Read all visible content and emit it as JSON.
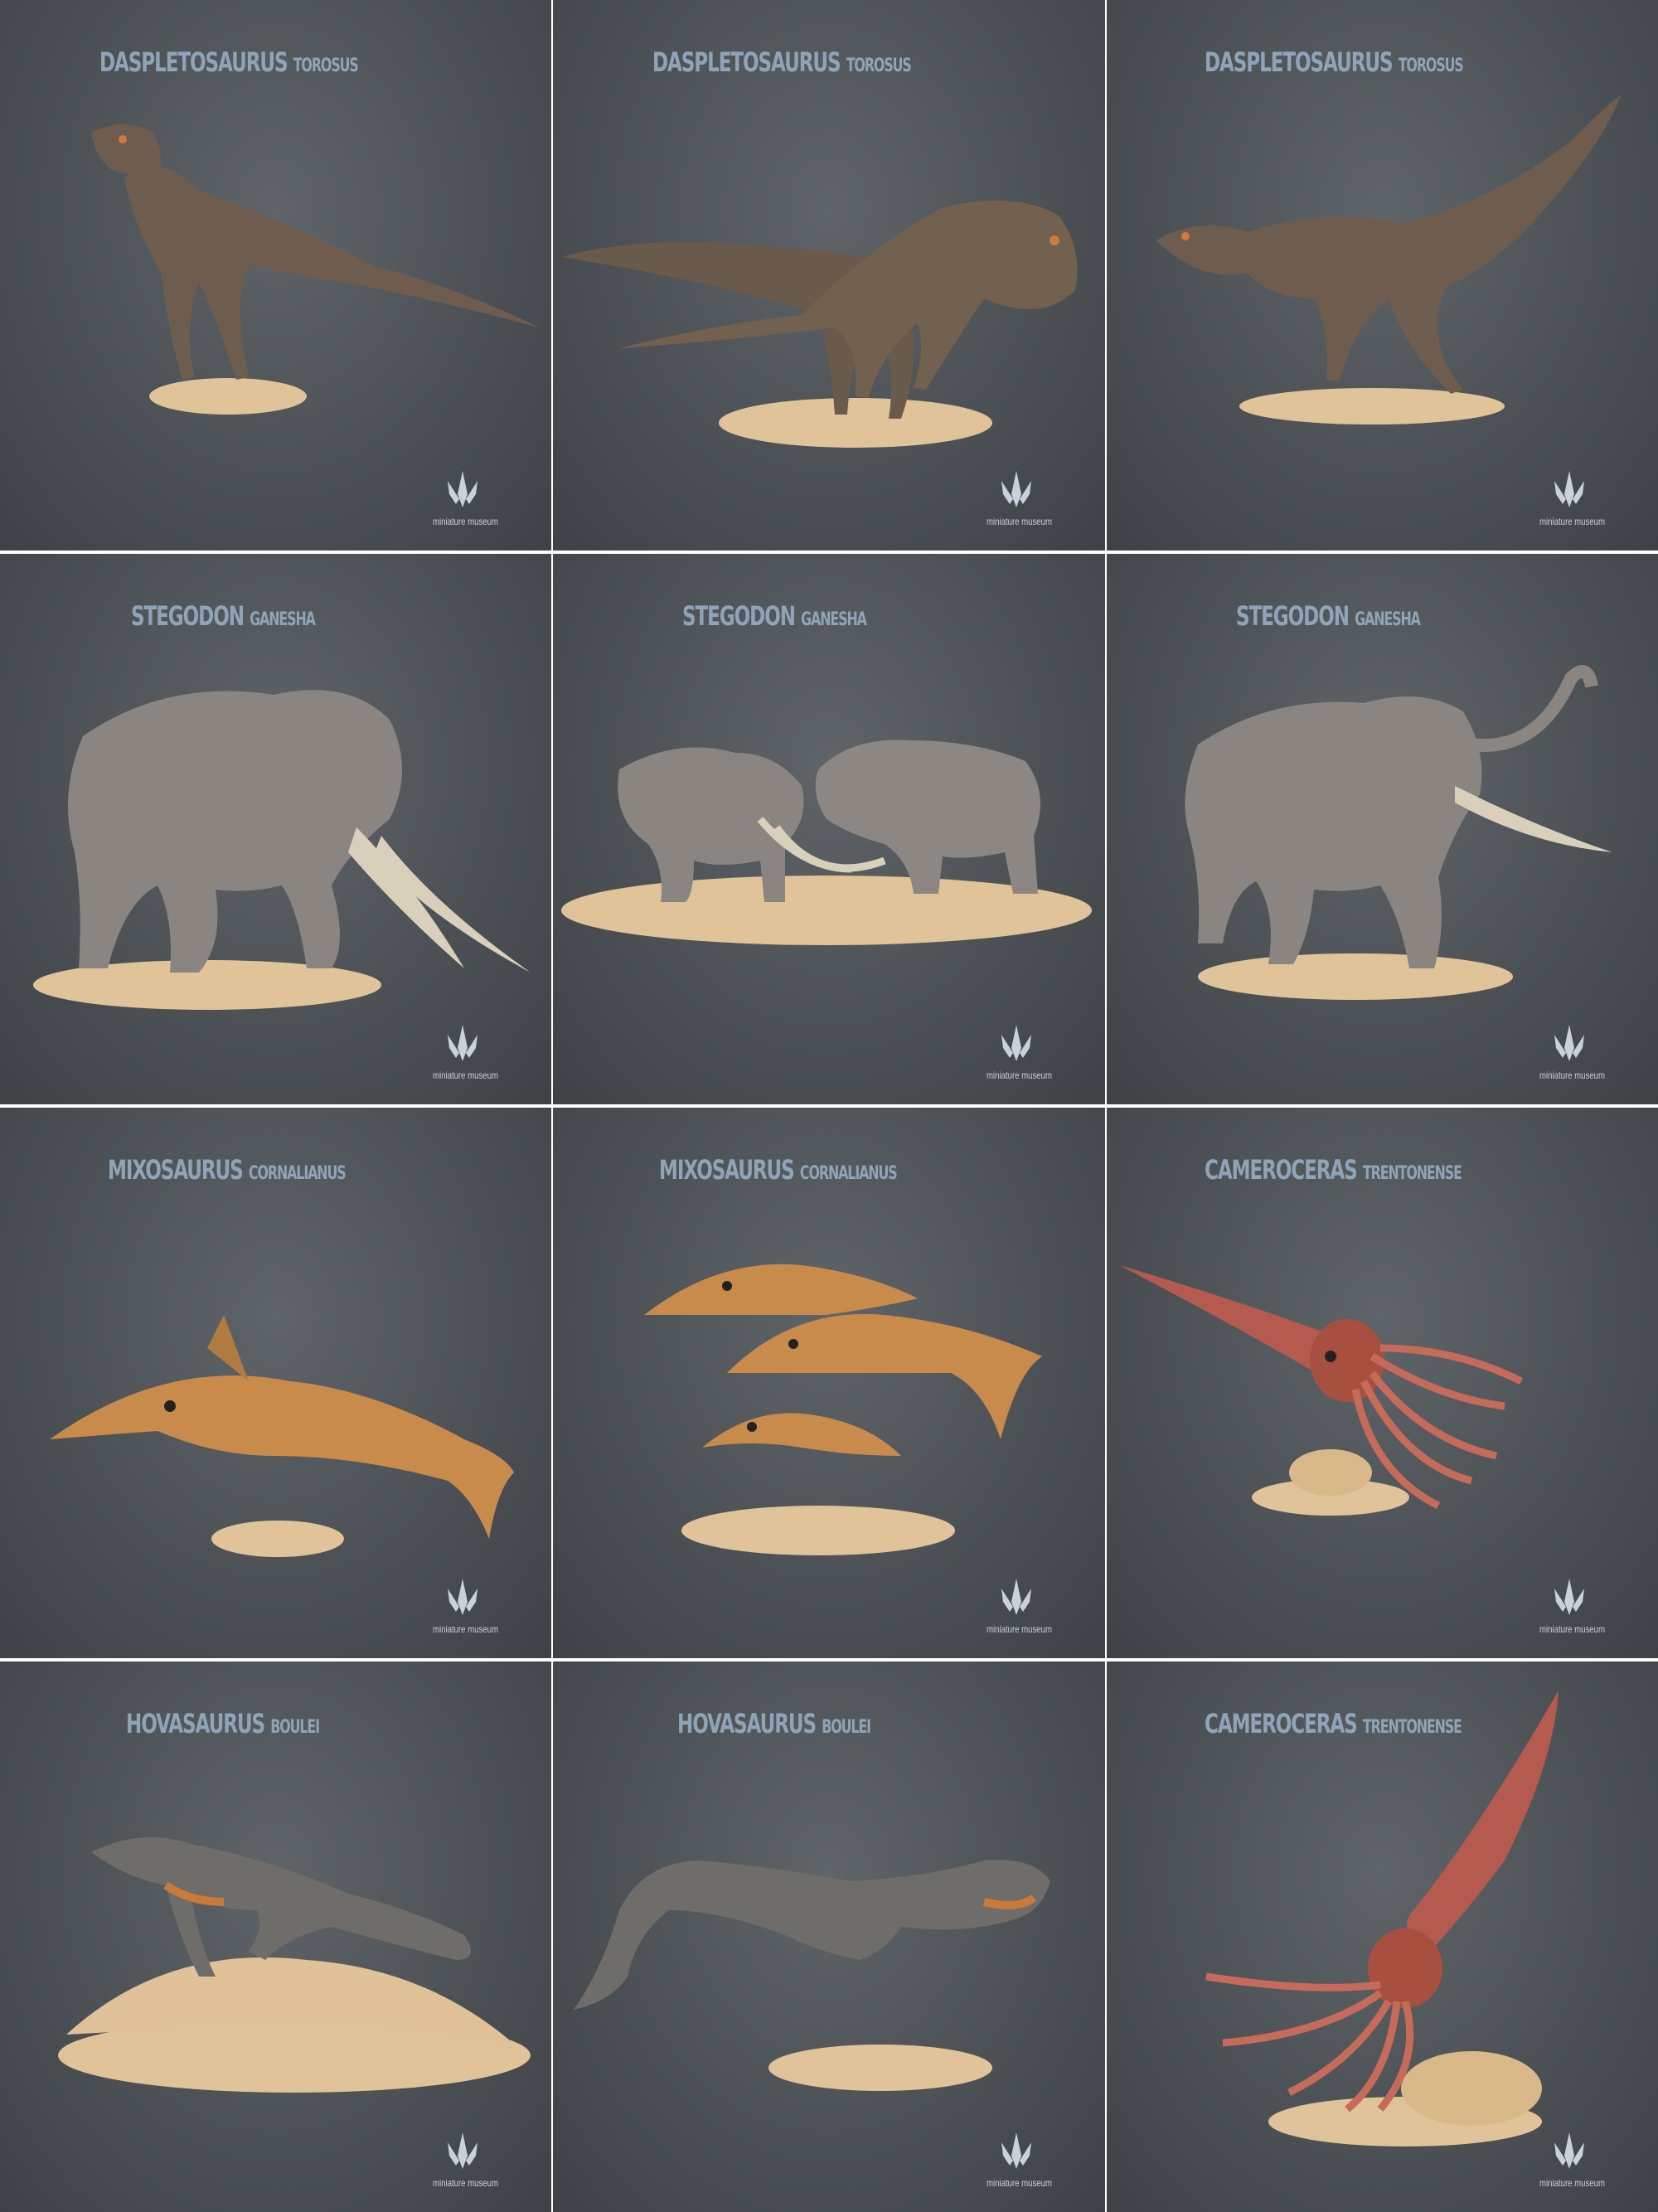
{
  "watermark": "miniature museum",
  "colors": {
    "title": "#8fa4b8",
    "base": "#e1c39a",
    "dino": "#6e5d4f",
    "elephant": "#8a8580",
    "ichthyosaur": "#c98b4b",
    "cephalopod": "#b45a4e",
    "hovasaurus": "#6f6d69"
  },
  "tiles": [
    {
      "genus": "DASPLETOSAURUS",
      "species": "TOROSUS",
      "subject": "tyrannosaur"
    },
    {
      "genus": "DASPLETOSAURUS",
      "species": "TOROSUS",
      "subject": "tyrannosaur"
    },
    {
      "genus": "DASPLETOSAURUS",
      "species": "TOROSUS",
      "subject": "tyrannosaur"
    },
    {
      "genus": "STEGODON",
      "species": "GANESHA",
      "subject": "stegodon"
    },
    {
      "genus": "STEGODON",
      "species": "GANESHA",
      "subject": "stegodon"
    },
    {
      "genus": "STEGODON",
      "species": "GANESHA",
      "subject": "stegodon"
    },
    {
      "genus": "MIXOSAURUS",
      "species": "CORNALIANUS",
      "subject": "ichthyosaur"
    },
    {
      "genus": "MIXOSAURUS",
      "species": "CORNALIANUS",
      "subject": "ichthyosaur"
    },
    {
      "genus": "CAMEROCERAS",
      "species": "TRENTONENSE",
      "subject": "cephalopod"
    },
    {
      "genus": "HOVASAURUS",
      "species": "BOULEI",
      "subject": "hovasaurus"
    },
    {
      "genus": "HOVASAURUS",
      "species": "BOULEI",
      "subject": "hovasaurus"
    },
    {
      "genus": "CAMEROCERAS",
      "species": "TRENTONENSE",
      "subject": "cephalopod"
    }
  ]
}
